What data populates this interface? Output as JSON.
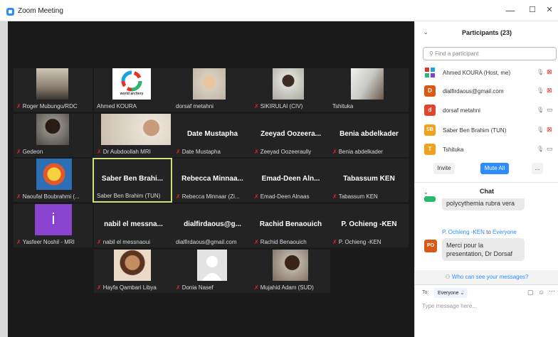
{
  "window": {
    "title": "Zoom Meeting",
    "minimize": "—",
    "maximize": "☐",
    "close": "✕"
  },
  "tiles": [
    {
      "name": "Roger Mubungu/RDC",
      "muted": true
    },
    {
      "name": "Ahmed KOURA",
      "muted": false
    },
    {
      "name": "dorsaf metahni",
      "muted": false
    },
    {
      "name": "SIKIRULAI (CIV)",
      "muted": true
    },
    {
      "name": "Tshituka",
      "muted": false
    },
    {
      "name": "Gedeon",
      "muted": true
    },
    {
      "name": "Dr Aubdoollah MRI",
      "muted": true
    },
    {
      "name": "Date Mustapha",
      "big": "Date Mustapha",
      "muted": true
    },
    {
      "name": "Zeeyad Oozeeraully",
      "big": "Zeeyad Oozeera...",
      "muted": true
    },
    {
      "name": "Benia abdelkader",
      "big": "Benia abdelkader",
      "muted": true
    },
    {
      "name": "Naoufal Boubrahmi (...",
      "muted": true
    },
    {
      "name": "Saber Ben Brahim (TUN)",
      "big": "Saber Ben Brahi...",
      "muted": false
    },
    {
      "name": "Rebecca Minnaar (Zi...",
      "big": "Rebecca Minnaa...",
      "muted": true
    },
    {
      "name": "Emad-Deen Alnaas",
      "big": "Emad-Deen Aln...",
      "muted": true
    },
    {
      "name": "Tabassum KEN",
      "big": "Tabassum KEN",
      "muted": true
    },
    {
      "name": "Yasfeer Noshil - MRI",
      "muted": true
    },
    {
      "name": "nabil el messnaoui",
      "big": "nabil el messna...",
      "muted": true
    },
    {
      "name": "dialfirdaous@gmail.com",
      "big": "dialfirdaous@g...",
      "muted": false
    },
    {
      "name": "Rachid Benaouich",
      "big": "Rachid Benaouich",
      "muted": true
    },
    {
      "name": "P. Ochieng -KEN",
      "big": "P. Ochieng -KEN",
      "muted": true
    },
    {
      "name": "Hayfa Qambari Libya",
      "muted": true
    },
    {
      "name": "Donia Nasef",
      "muted": true
    },
    {
      "name": "Mujahid Adam (SUD)",
      "muted": true
    }
  ],
  "logo_text": "world archery",
  "participants": {
    "header": "Participants (23)",
    "search_placeholder": "Find a participant",
    "list": [
      {
        "initial": "",
        "name": "Ahmed KOURA (Host, me)",
        "color": "#7b3fe4",
        "video": "off"
      },
      {
        "initial": "D",
        "name": "dialfirdaous@gmail.com",
        "color": "#d95a16",
        "video": "off"
      },
      {
        "initial": "d",
        "name": "dorsaf metahni",
        "color": "#e0452e",
        "video": "on"
      },
      {
        "initial": "SB",
        "name": "Saber Ben Brahim (TUN)",
        "color": "#f0a21f",
        "video": "off"
      },
      {
        "initial": "T",
        "name": "Tshituka",
        "color": "#f0a21f",
        "video": "on"
      }
    ],
    "invite": "Invite",
    "mute_all": "Mute All",
    "more": "..."
  },
  "chat": {
    "header": "Chat",
    "msg1": "polycythemia rubra vera",
    "sender_from": "P. Ochieng -KEN",
    "sender_to_word": "to",
    "sender_to": "Everyone",
    "avatar2": "PO",
    "msg2": "Merci pour la presentation, Dr Dorsaf",
    "who_can_see": "Who can see your messages?",
    "to_label": "To:",
    "to_value": "Everyone",
    "placeholder": "Type message here..."
  },
  "colors": {
    "accent": "#2d8cff",
    "active_border": "#cfe27a",
    "muted_mic": "#e02828"
  }
}
